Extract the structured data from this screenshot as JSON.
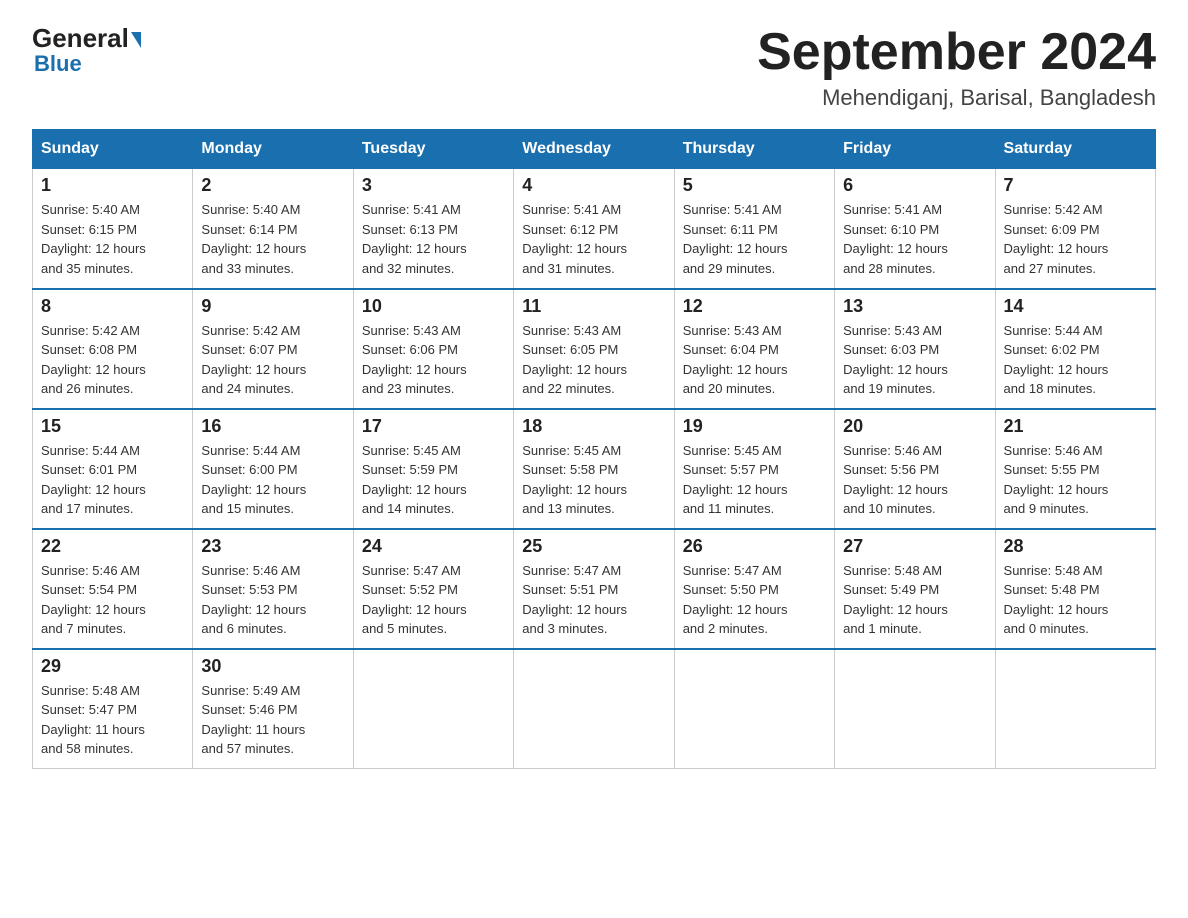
{
  "logo": {
    "general": "General",
    "blue": "Blue"
  },
  "header": {
    "title": "September 2024",
    "subtitle": "Mehendiganj, Barisal, Bangladesh"
  },
  "columns": [
    "Sunday",
    "Monday",
    "Tuesday",
    "Wednesday",
    "Thursday",
    "Friday",
    "Saturday"
  ],
  "weeks": [
    [
      {
        "day": "1",
        "sunrise": "5:40 AM",
        "sunset": "6:15 PM",
        "daylight": "12 hours and 35 minutes."
      },
      {
        "day": "2",
        "sunrise": "5:40 AM",
        "sunset": "6:14 PM",
        "daylight": "12 hours and 33 minutes."
      },
      {
        "day": "3",
        "sunrise": "5:41 AM",
        "sunset": "6:13 PM",
        "daylight": "12 hours and 32 minutes."
      },
      {
        "day": "4",
        "sunrise": "5:41 AM",
        "sunset": "6:12 PM",
        "daylight": "12 hours and 31 minutes."
      },
      {
        "day": "5",
        "sunrise": "5:41 AM",
        "sunset": "6:11 PM",
        "daylight": "12 hours and 29 minutes."
      },
      {
        "day": "6",
        "sunrise": "5:41 AM",
        "sunset": "6:10 PM",
        "daylight": "12 hours and 28 minutes."
      },
      {
        "day": "7",
        "sunrise": "5:42 AM",
        "sunset": "6:09 PM",
        "daylight": "12 hours and 27 minutes."
      }
    ],
    [
      {
        "day": "8",
        "sunrise": "5:42 AM",
        "sunset": "6:08 PM",
        "daylight": "12 hours and 26 minutes."
      },
      {
        "day": "9",
        "sunrise": "5:42 AM",
        "sunset": "6:07 PM",
        "daylight": "12 hours and 24 minutes."
      },
      {
        "day": "10",
        "sunrise": "5:43 AM",
        "sunset": "6:06 PM",
        "daylight": "12 hours and 23 minutes."
      },
      {
        "day": "11",
        "sunrise": "5:43 AM",
        "sunset": "6:05 PM",
        "daylight": "12 hours and 22 minutes."
      },
      {
        "day": "12",
        "sunrise": "5:43 AM",
        "sunset": "6:04 PM",
        "daylight": "12 hours and 20 minutes."
      },
      {
        "day": "13",
        "sunrise": "5:43 AM",
        "sunset": "6:03 PM",
        "daylight": "12 hours and 19 minutes."
      },
      {
        "day": "14",
        "sunrise": "5:44 AM",
        "sunset": "6:02 PM",
        "daylight": "12 hours and 18 minutes."
      }
    ],
    [
      {
        "day": "15",
        "sunrise": "5:44 AM",
        "sunset": "6:01 PM",
        "daylight": "12 hours and 17 minutes."
      },
      {
        "day": "16",
        "sunrise": "5:44 AM",
        "sunset": "6:00 PM",
        "daylight": "12 hours and 15 minutes."
      },
      {
        "day": "17",
        "sunrise": "5:45 AM",
        "sunset": "5:59 PM",
        "daylight": "12 hours and 14 minutes."
      },
      {
        "day": "18",
        "sunrise": "5:45 AM",
        "sunset": "5:58 PM",
        "daylight": "12 hours and 13 minutes."
      },
      {
        "day": "19",
        "sunrise": "5:45 AM",
        "sunset": "5:57 PM",
        "daylight": "12 hours and 11 minutes."
      },
      {
        "day": "20",
        "sunrise": "5:46 AM",
        "sunset": "5:56 PM",
        "daylight": "12 hours and 10 minutes."
      },
      {
        "day": "21",
        "sunrise": "5:46 AM",
        "sunset": "5:55 PM",
        "daylight": "12 hours and 9 minutes."
      }
    ],
    [
      {
        "day": "22",
        "sunrise": "5:46 AM",
        "sunset": "5:54 PM",
        "daylight": "12 hours and 7 minutes."
      },
      {
        "day": "23",
        "sunrise": "5:46 AM",
        "sunset": "5:53 PM",
        "daylight": "12 hours and 6 minutes."
      },
      {
        "day": "24",
        "sunrise": "5:47 AM",
        "sunset": "5:52 PM",
        "daylight": "12 hours and 5 minutes."
      },
      {
        "day": "25",
        "sunrise": "5:47 AM",
        "sunset": "5:51 PM",
        "daylight": "12 hours and 3 minutes."
      },
      {
        "day": "26",
        "sunrise": "5:47 AM",
        "sunset": "5:50 PM",
        "daylight": "12 hours and 2 minutes."
      },
      {
        "day": "27",
        "sunrise": "5:48 AM",
        "sunset": "5:49 PM",
        "daylight": "12 hours and 1 minute."
      },
      {
        "day": "28",
        "sunrise": "5:48 AM",
        "sunset": "5:48 PM",
        "daylight": "12 hours and 0 minutes."
      }
    ],
    [
      {
        "day": "29",
        "sunrise": "5:48 AM",
        "sunset": "5:47 PM",
        "daylight": "11 hours and 58 minutes."
      },
      {
        "day": "30",
        "sunrise": "5:49 AM",
        "sunset": "5:46 PM",
        "daylight": "11 hours and 57 minutes."
      },
      null,
      null,
      null,
      null,
      null
    ]
  ],
  "labels": {
    "sunrise": "Sunrise:",
    "sunset": "Sunset:",
    "daylight": "Daylight:"
  }
}
